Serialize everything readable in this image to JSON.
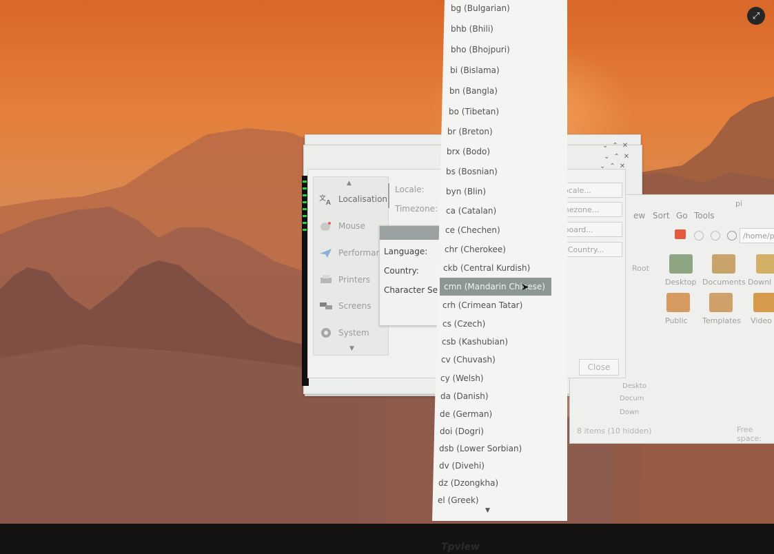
{
  "prefs": {
    "sidebar": [
      {
        "label": "Localisation",
        "icon": "localisation-icon"
      },
      {
        "label": "Mouse",
        "icon": "mouse-icon"
      },
      {
        "label": "Performance",
        "icon": "performance-icon"
      },
      {
        "label": "Printers",
        "icon": "printer-icon"
      },
      {
        "label": "Screens",
        "icon": "screens-icon"
      },
      {
        "label": "System",
        "icon": "gear-icon"
      }
    ],
    "locale_label": "Locale:",
    "timezone_label": "Timezone:",
    "locale_btn": "Locale...",
    "timezone_btn": "imezone...",
    "keyboard_btn": "yboard...",
    "wifi_btn": "N Country...",
    "close_label": "Close"
  },
  "dialog": {
    "language_label": "Language:",
    "country_label": "Country:",
    "charset_label": "Character Set:"
  },
  "dropdown": {
    "items": [
      "bg (Bulgarian)",
      "bhb (Bhili)",
      "bho (Bhojpuri)",
      "bi (Bislama)",
      "bn (Bangla)",
      "bo (Tibetan)",
      "br (Breton)",
      "brx (Bodo)",
      "bs (Bosnian)",
      "byn (Blin)",
      "ca (Catalan)",
      "ce (Chechen)",
      "chr (Cherokee)",
      "ckb (Central Kurdish)",
      "cmn (Mandarin Chinese)",
      "crh (Crimean Tatar)",
      "cs (Czech)",
      "csb (Kashubian)",
      "cv (Chuvash)",
      "cy (Welsh)",
      "da (Danish)",
      "de (German)",
      "doi (Dogri)",
      "dsb (Lower Sorbian)",
      "dv (Divehi)",
      "dz (Dzongkha)",
      "el (Greek)"
    ],
    "selected_index": 14
  },
  "filemanager": {
    "title": "pi",
    "menu": [
      "ew",
      "Sort",
      "Go",
      "Tools"
    ],
    "path": "/home/pi",
    "side": {
      "root": "Root",
      "desktop": "Deskto",
      "documents": "Docum",
      "downloads": "Down"
    },
    "icons": [
      "Desktop",
      "Documents",
      "Downl",
      "Public",
      "Templates",
      "Video"
    ],
    "status_items": "8 items (10 hidden)",
    "status_free": "Free space:"
  },
  "brand": "Tpvlew",
  "colors": {
    "selection": "#8b9695",
    "accent_terminal": "#2fd42f"
  }
}
